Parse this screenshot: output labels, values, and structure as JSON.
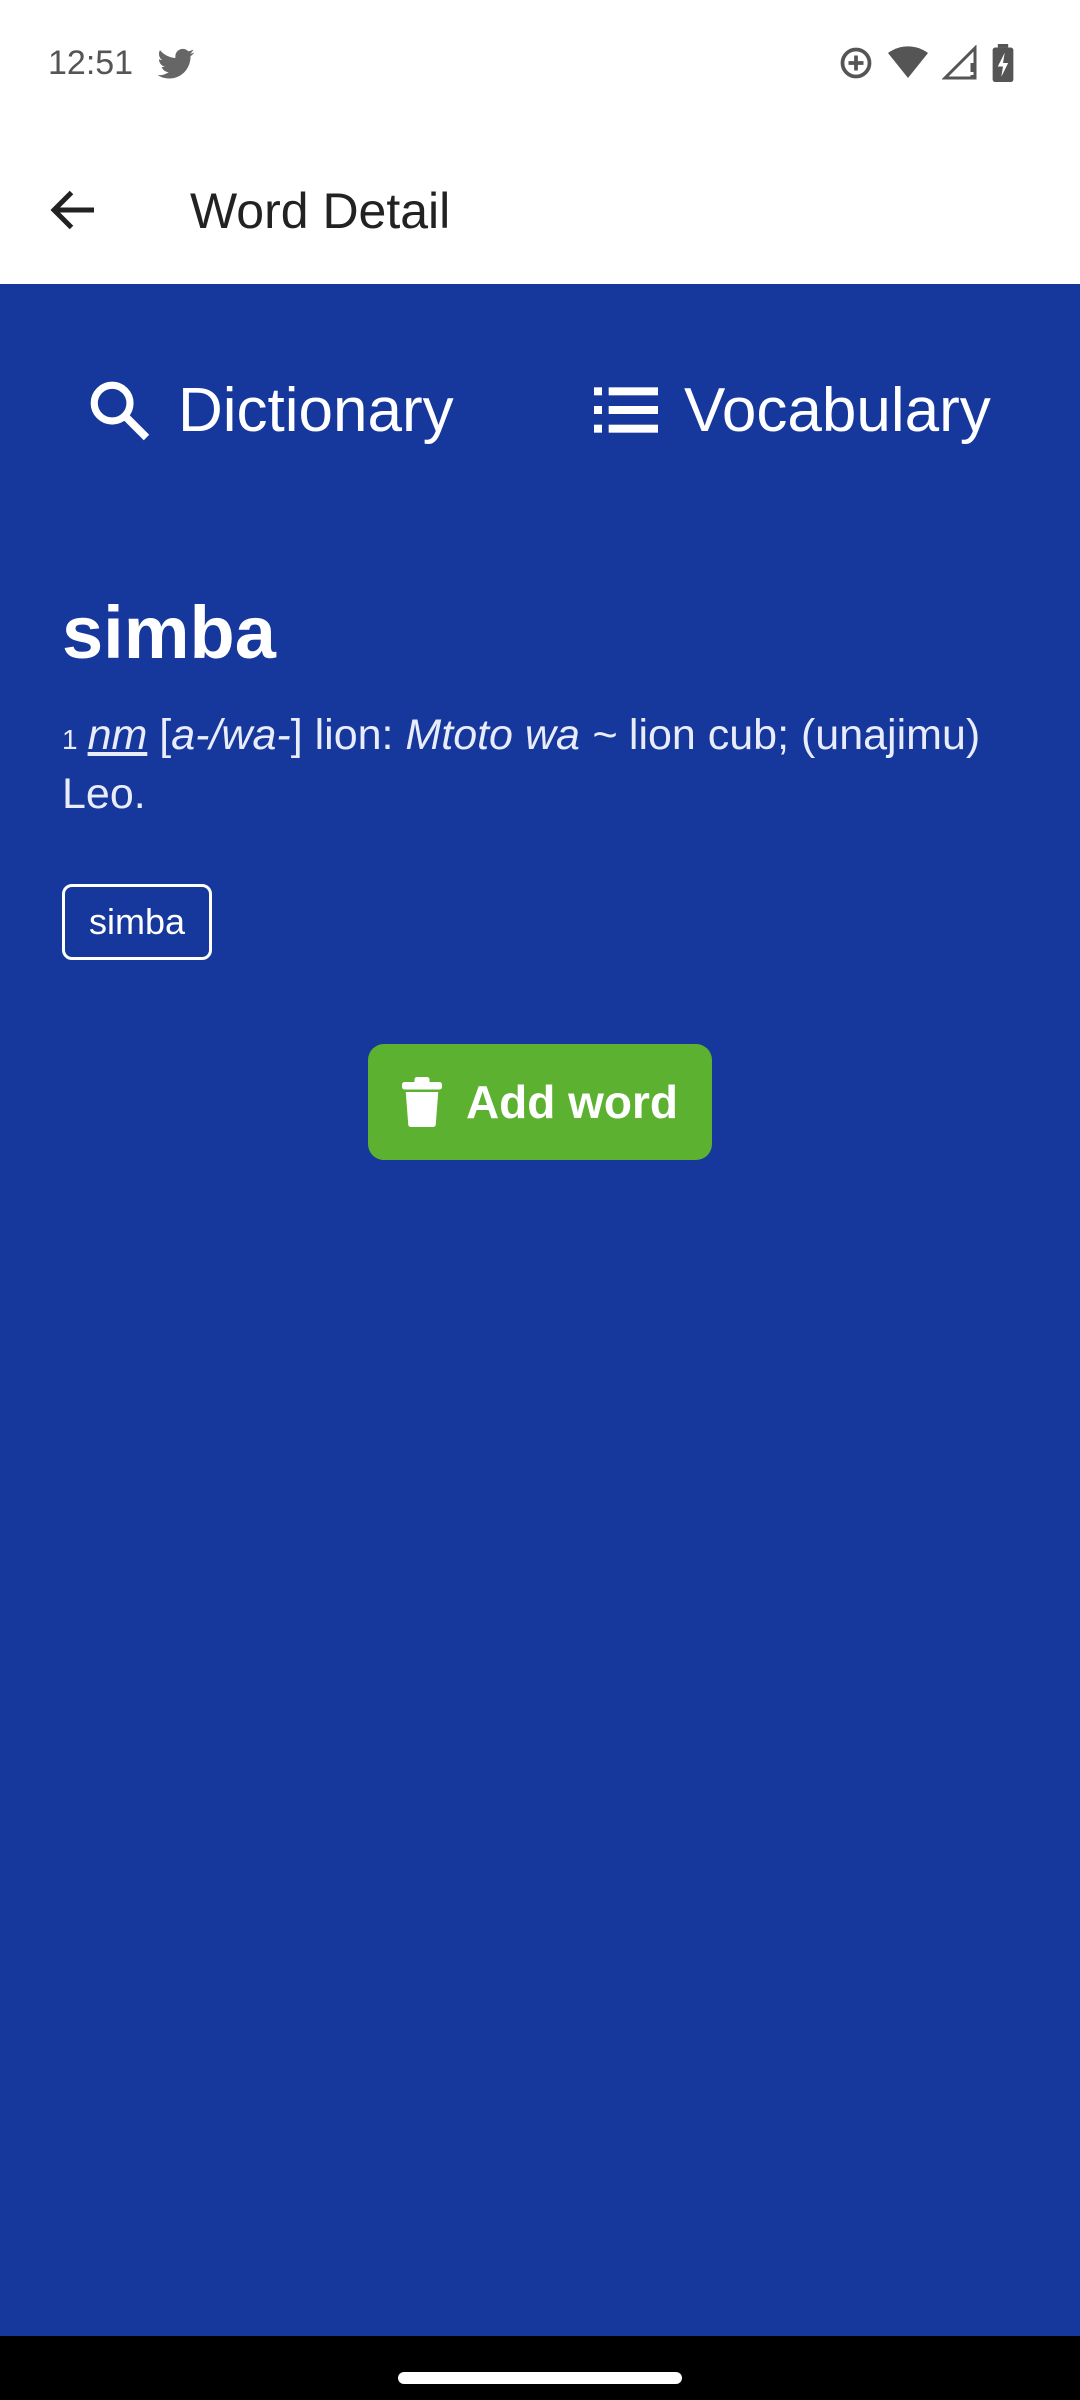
{
  "status_bar": {
    "time": "12:51",
    "icons": [
      "twitter-icon",
      "data-saver-icon",
      "wifi-icon",
      "signal-icon",
      "battery-charging-icon"
    ]
  },
  "app_bar": {
    "back_icon": "arrow-back-icon",
    "title": "Word Detail"
  },
  "tabs": [
    {
      "label": "Dictionary",
      "icon": "search-icon"
    },
    {
      "label": "Vocabulary",
      "icon": "list-icon"
    }
  ],
  "word": {
    "headword": "simba",
    "definition": {
      "number": "1",
      "part_of_speech": "nm",
      "class_open": "[",
      "noun_class": "a-/wa-",
      "class_close": "]",
      "meaning": " lion: ",
      "example": "Mtoto wa ~",
      "example_translation": " lion cub; (unajimu) Leo."
    },
    "tag": "simba"
  },
  "action_button": {
    "label": "Add word",
    "icon": "trash-icon"
  },
  "colors": {
    "background": "#16389c",
    "button": "#5cb130",
    "app_bar": "#ffffff"
  }
}
